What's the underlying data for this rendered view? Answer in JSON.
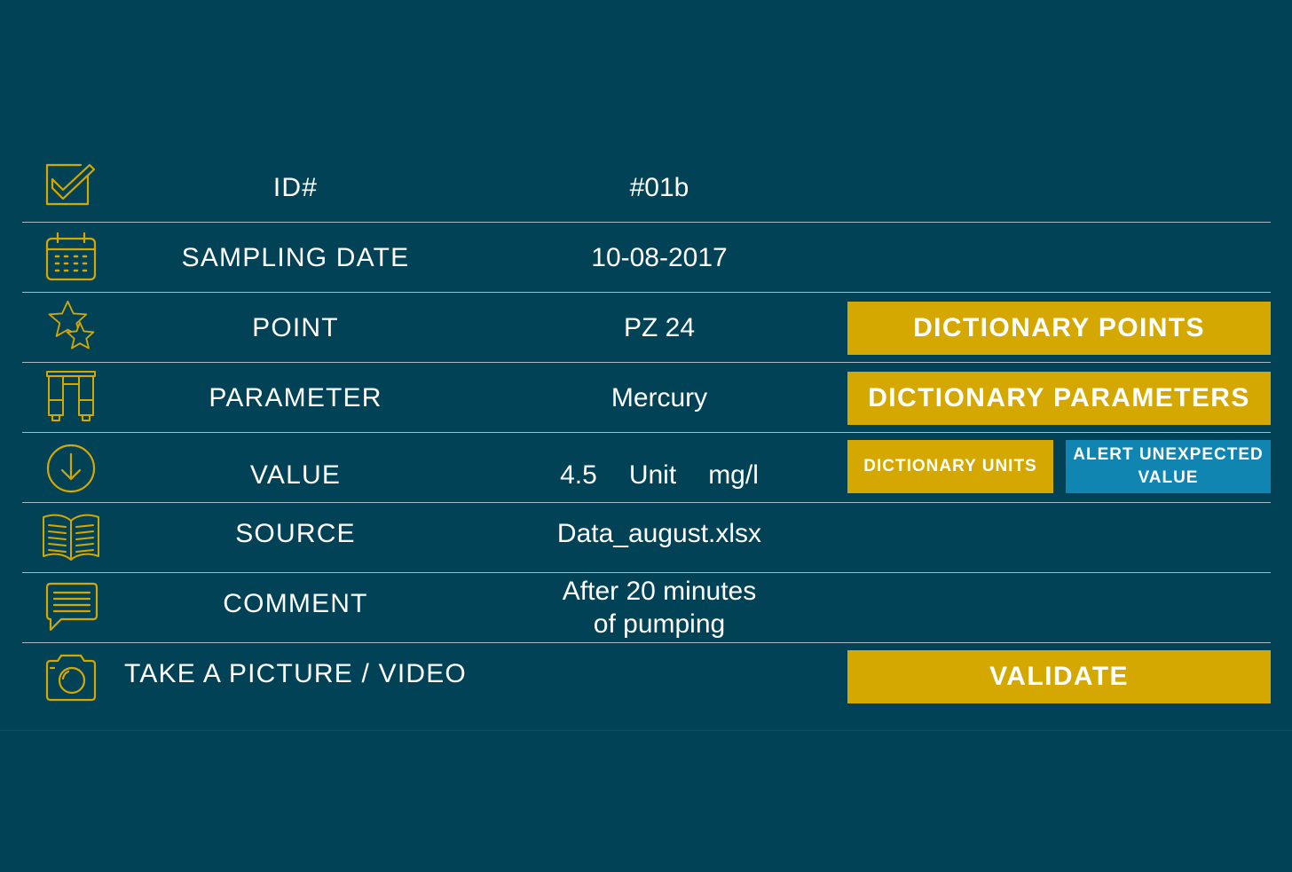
{
  "form": {
    "rows": [
      {
        "label": "ID#",
        "value": "#01b",
        "icon": "checkbox-icon"
      },
      {
        "label": "SAMPLING DATE",
        "value": "10-08-2017",
        "icon": "calendar-icon"
      },
      {
        "label": "POINT",
        "value": "PZ 24",
        "icon": "stars-icon"
      },
      {
        "label": "PARAMETER",
        "value": "Mercury",
        "icon": "test-tubes-icon"
      },
      {
        "label": "VALUE",
        "value": "4.5",
        "unit_label": "Unit",
        "unit": "mg/l",
        "icon": "download-circle-icon"
      },
      {
        "label": "SOURCE",
        "value": "Data_august.xlsx",
        "icon": "book-icon"
      },
      {
        "label": "COMMENT",
        "value_line1": "After 20 minutes",
        "value_line2": "of pumping",
        "icon": "chat-bubble-icon"
      },
      {
        "label": "TAKE A PICTURE / VIDEO",
        "icon": "camera-icon"
      }
    ]
  },
  "buttons": {
    "dictionary_points": "DICTIONARY POINTS",
    "dictionary_parameters": "DICTIONARY PARAMETERS",
    "dictionary_units": "DICTIONARY UNITS",
    "alert_unexpected_value": "ALERT UNEXPECTED VALUE",
    "validate": "VALIDATE"
  },
  "colors": {
    "background": "#024257",
    "accent_gold": "#d4a800",
    "alert_blue": "#1185b2",
    "separator": "#aab8bf"
  }
}
